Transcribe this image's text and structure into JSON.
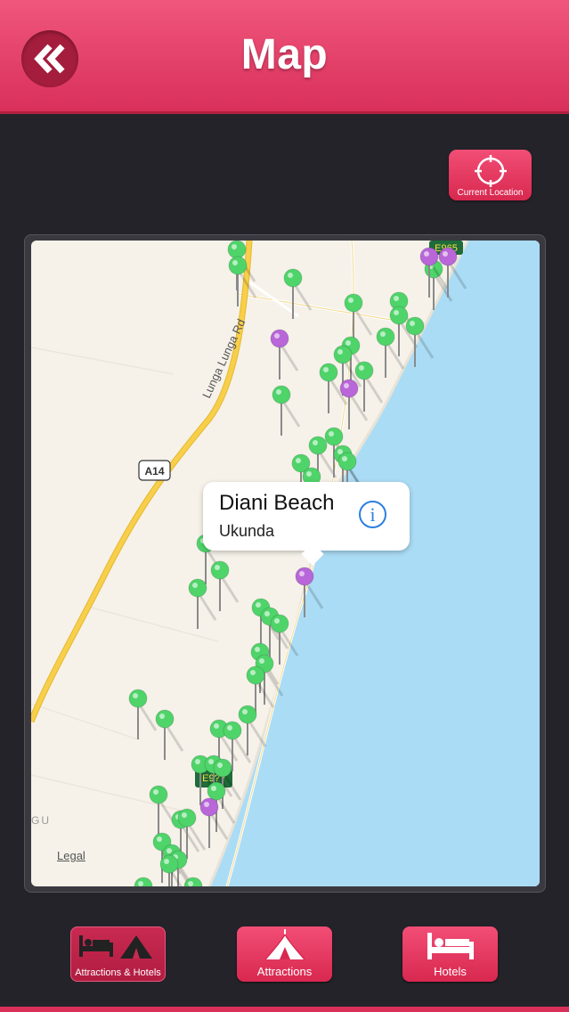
{
  "header": {
    "title": "Map",
    "back_icon": "double-chevron-left-icon"
  },
  "current_location": {
    "label": "Current Location",
    "icon": "crosshair-icon"
  },
  "map": {
    "road_labels": [
      "Lunga Lunga Rd",
      "A14",
      "E965",
      "E9??"
    ],
    "edge_label": "GU",
    "legal": "Legal",
    "colors": {
      "land": "#f6f2ea",
      "water": "#abdcf5",
      "pin_attraction": "#4fd46a",
      "pin_hotel": "#b866d8",
      "highway": "#f5c842"
    }
  },
  "callout": {
    "title": "Diani Beach",
    "subtitle": "Ukunda",
    "info_icon": "info-icon"
  },
  "tabs": [
    {
      "label": "Attractions & Hotels",
      "icon": "bed-tent-icon",
      "active": true
    },
    {
      "label": "Attractions",
      "icon": "tent-icon",
      "active": false
    },
    {
      "label": "Hotels",
      "icon": "bed-icon",
      "active": false
    }
  ]
}
